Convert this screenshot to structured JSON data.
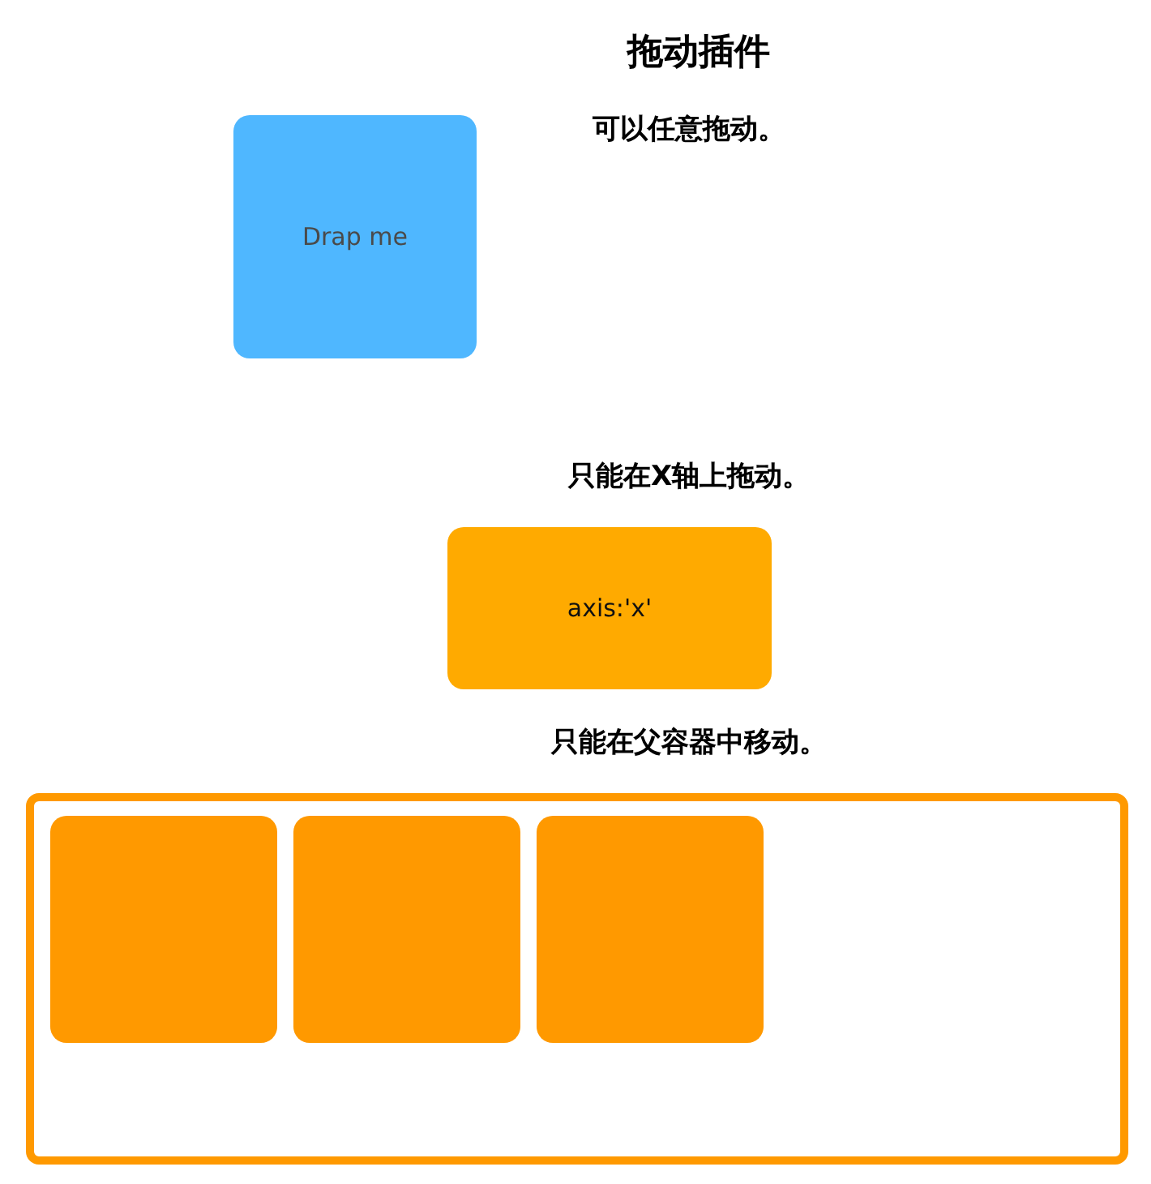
{
  "title": "拖动插件",
  "sections": [
    {
      "kind": "free",
      "heading": "可以任意拖动。",
      "items": [
        {
          "kind": "square",
          "label": "Drap me"
        }
      ]
    },
    {
      "kind": "axis",
      "heading": "只能在X轴上拖动。",
      "items": [
        {
          "kind": "wide",
          "label": "axis:'x'"
        }
      ]
    },
    {
      "kind": "contained",
      "heading": "只能在父容器中移动。",
      "items": [
        {
          "kind": "tile"
        },
        {
          "kind": "tile"
        },
        {
          "kind": "tile"
        }
      ]
    }
  ]
}
